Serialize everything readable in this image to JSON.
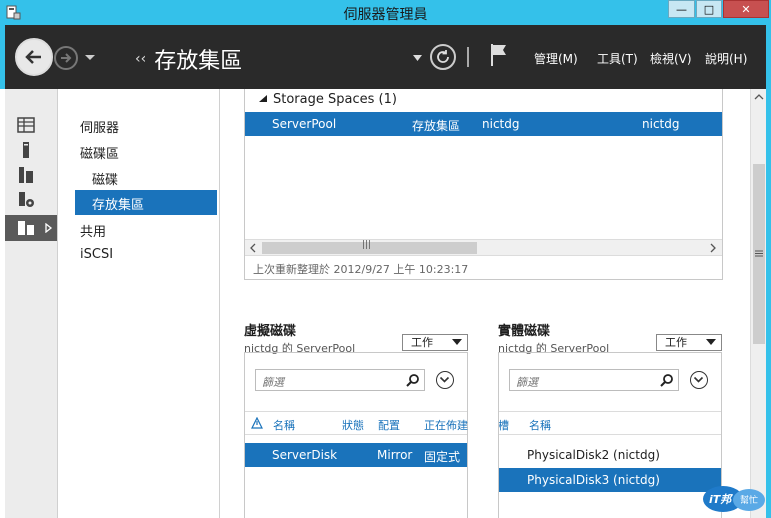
{
  "window": {
    "title": "伺服器管理員",
    "minimize": "—",
    "maximize": "□",
    "close": "✕"
  },
  "toolbar": {
    "breadcrumb_arrows": "‹‹",
    "breadcrumb": "存放集區",
    "menu": [
      "管理(M)",
      "工具(T)",
      "檢視(V)",
      "說明(H)"
    ]
  },
  "tree": {
    "items": [
      {
        "label": "伺服器"
      },
      {
        "label": "磁碟區"
      },
      {
        "label": "磁碟"
      },
      {
        "label": "存放集區"
      },
      {
        "label": "共用"
      },
      {
        "label": "iSCSI"
      }
    ]
  },
  "pools": {
    "group_header": "Storage Spaces (1)",
    "row": {
      "name": "ServerPool",
      "type": "存放集區",
      "managed_by": "nictdg",
      "available_to": "nictdg"
    },
    "refresh_text": "上次重新整理於 2012/9/27 上午 10:23:17",
    "scroll_grip": "|||"
  },
  "virtual_disks": {
    "title": "虛擬磁碟",
    "subtitle": "nictdg 的 ServerPool",
    "task_label": "工作",
    "filter_placeholder": "篩選",
    "columns": [
      "名稱",
      "狀態",
      "配置",
      "正在佈建"
    ],
    "rows": [
      {
        "name": "ServerDisk",
        "layout": "Mirror",
        "provisioning": "固定式"
      }
    ]
  },
  "physical_disks": {
    "title": "實體磁碟",
    "subtitle": "nictdg 的 ServerPool",
    "task_label": "工作",
    "filter_placeholder": "篩選",
    "columns": [
      "插槽",
      "名稱"
    ],
    "rows": [
      {
        "name": "PhysicalDisk2 (nictdg)"
      },
      {
        "name": "PhysicalDisk3 (nictdg)"
      }
    ]
  },
  "watermark": {
    "text_top": "iT邦",
    "text_bottom": "幫忙"
  },
  "colors": {
    "accent": "#34c1ea",
    "selection": "#1a73bb",
    "toolbar_bg": "#2a2a2a"
  }
}
